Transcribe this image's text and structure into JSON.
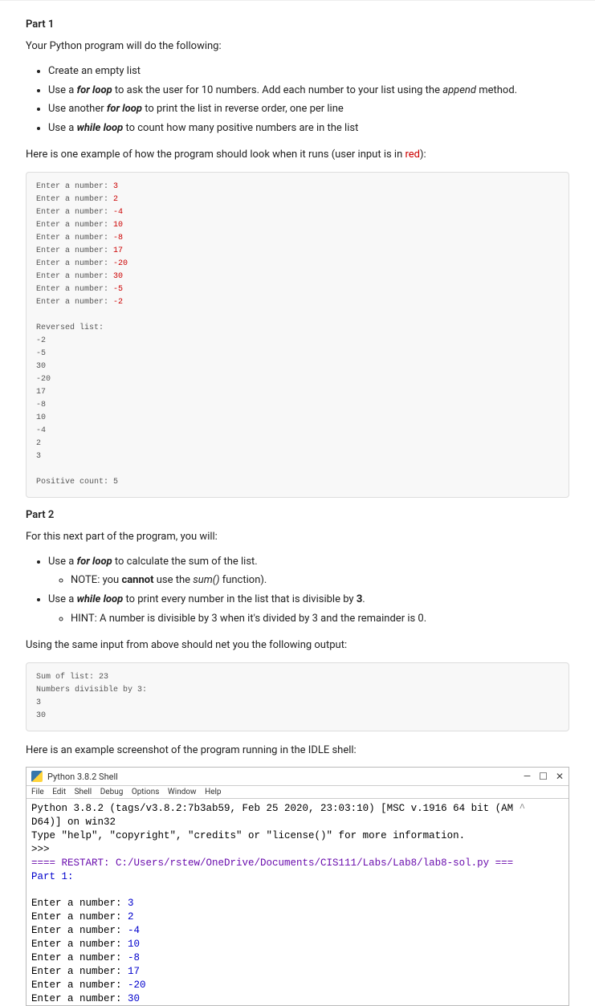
{
  "part1": {
    "heading": "Part 1",
    "intro": "Your Python program will do the following:",
    "bullets": {
      "b1_a": "Create an empty list",
      "b2_a": "Use a ",
      "b2_b": "for loop",
      "b2_c": " to ask the user for 10 numbers. Add each number to your list using the ",
      "b2_d": "append",
      "b2_e": " method.",
      "b3_a": "Use another ",
      "b3_b": "for loop",
      "b3_c": " to print the list in reverse order, one per line",
      "b4_a": "Use a ",
      "b4_b": "while loop",
      "b4_c": " to count how many positive numbers are in the list"
    },
    "example_intro_a": "Here is one example of how the program should look when it runs (user input is in ",
    "example_intro_b": "red",
    "example_intro_c": "):",
    "code": {
      "prompt": "Enter a number: ",
      "inputs": [
        "3",
        "2",
        "-4",
        "10",
        "-8",
        "17",
        "-20",
        "30",
        "-5",
        "-2"
      ],
      "rev_label": "Reversed list:",
      "rev": [
        "-2",
        "-5",
        "30",
        "-20",
        "17",
        "-8",
        "10",
        "-4",
        "2",
        "3"
      ],
      "pos": "Positive count: 5"
    }
  },
  "part2": {
    "heading": "Part 2",
    "intro": "For this next part of the program, you will:",
    "bullets": {
      "b1_a": "Use a ",
      "b1_b": "for loop",
      "b1_c": " to calculate the sum of the list.",
      "b1_sub_a": "NOTE: you ",
      "b1_sub_b": "cannot",
      "b1_sub_c": " use the ",
      "b1_sub_d": "sum()",
      "b1_sub_e": " function).",
      "b2_a": "Use a ",
      "b2_b": "while loop",
      "b2_c": " to print every number in the list that is divisible by ",
      "b2_d": "3",
      "b2_e": ".",
      "b2_sub": "HINT: A number is divisible by 3 when it's divided by 3  and the remainder is 0."
    },
    "output_intro": "Using the same input from above should net you the following output:",
    "code": {
      "l1": "Sum of list: 23",
      "l2": "Numbers divisible by 3:",
      "l3": "3",
      "l4": "30"
    },
    "screenshot_intro": "Here is an example screenshot of the program running in the IDLE shell:"
  },
  "idle": {
    "title": "Python 3.8.2 Shell",
    "menu": [
      "File",
      "Edit",
      "Shell",
      "Debug",
      "Options",
      "Window",
      "Help"
    ],
    "minimize": "—",
    "maximize": "☐",
    "close": "✕",
    "caret": "^",
    "line1a": "Python 3.8.2 (tags/v3.8.2:7b3ab59, Feb 25 2020, 23:03:10) [MSC v.1916 64 bit (AM",
    "line1b": "D64)] on win32",
    "line2a": "Type \"help\", \"copyright\", \"credits\" or \"license()\" for more information.",
    "prompt": ">>> ",
    "restart": "==== RESTART: C:/Users/rstew/OneDrive/Documents/CIS111/Labs/Lab8/lab8-sol.py ===",
    "part1label": "Part 1:",
    "np": "Enter a number: ",
    "n": [
      "3",
      "2",
      "-4",
      "10",
      "-8",
      "17",
      "-20",
      "30"
    ]
  }
}
